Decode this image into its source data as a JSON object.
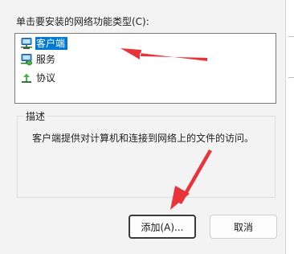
{
  "dialog": {
    "prompt": "单击要安装的网络功能类型(C):",
    "list": {
      "items": [
        {
          "label": "客户端",
          "icon": "network-client-icon",
          "selected": true
        },
        {
          "label": "服务",
          "icon": "network-service-icon",
          "selected": false
        },
        {
          "label": "协议",
          "icon": "network-protocol-icon",
          "selected": false
        }
      ]
    },
    "description_group": {
      "title": "描述",
      "text": "客户端提供对计算机和连接到网络上的文件的访问。"
    },
    "buttons": {
      "add": "添加(A)...",
      "cancel": "取消"
    }
  },
  "annotations": {
    "arrow_color": "#e8333a",
    "items": [
      "red-arrow-to-client-item",
      "red-arrow-to-add-button"
    ]
  },
  "colors": {
    "selection": "#0078d7",
    "dialog_background": "#f3f3f3"
  }
}
